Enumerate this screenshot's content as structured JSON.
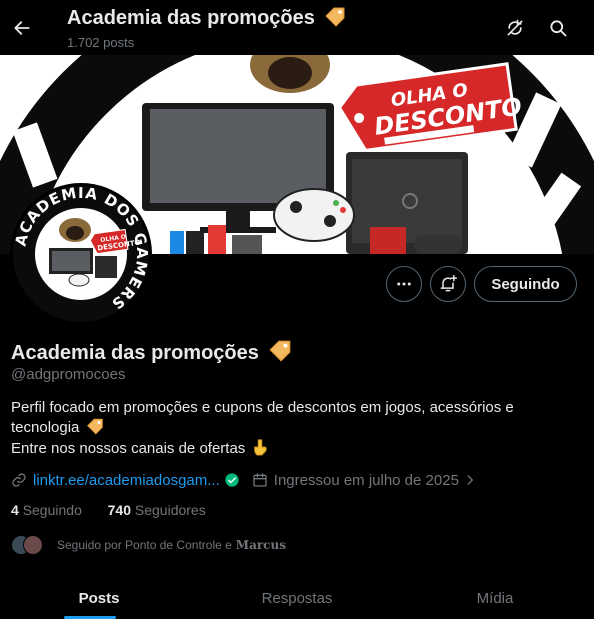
{
  "header": {
    "title": "Academia das promoções",
    "post_count": "1.702 posts"
  },
  "banner": {
    "sticker_line1": "OLHA O",
    "sticker_line2": "DESCONTO"
  },
  "avatar": {
    "ring_text": "ACADEMIA DOS GAMERS",
    "sticker_line1": "OLHA O",
    "sticker_line2": "DESCONTO"
  },
  "actions": {
    "follow_label": "Seguindo"
  },
  "profile": {
    "name": "Academia das promoções",
    "handle": "@adgpromocoes",
    "bio_line1": "Perfil focado em promoções e cupons de descontos em jogos, acessórios e",
    "bio_line2": "tecnologia",
    "bio_line3": "Entre nos nossos canais de ofertas",
    "link": "linktr.ee/academiadosgam...",
    "joined": "Ingressou em julho de 2025"
  },
  "stats": {
    "following_count": "4",
    "following_label": "Seguindo",
    "followers_count": "740",
    "followers_label": "Seguidores"
  },
  "followed_by": {
    "prefix": "Seguido por Ponto de Controle e",
    "last": "Marcus"
  },
  "tabs": [
    "Posts",
    "Respostas",
    "Mídia"
  ],
  "colors": {
    "accent": "#1d9bf0",
    "verified": "#00ba7c",
    "background": "#000000",
    "secondary_text": "#71767b"
  },
  "icons": {
    "back": "arrow-left-icon",
    "refresh": "refresh-crossed-icon",
    "search": "search-icon",
    "more": "more-horizontal-icon",
    "notify": "bell-plus-icon",
    "link": "link-icon",
    "calendar": "calendar-icon",
    "tag": "price-tag-emoji",
    "point_down": "point-down-emoji"
  }
}
